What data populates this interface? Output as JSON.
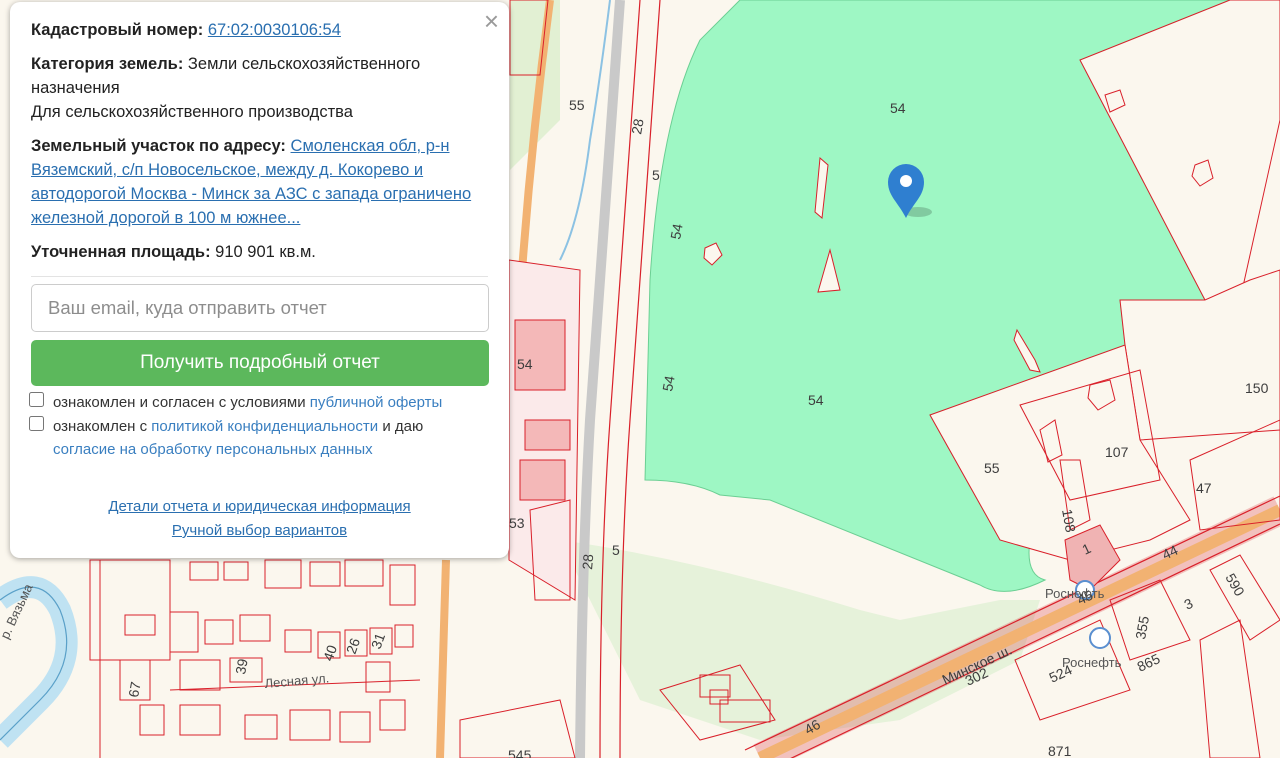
{
  "popup": {
    "close_icon": "×",
    "cadastral_label": "Кадастровый номер:",
    "cadastral_number": "67:02:0030106:54",
    "category_label": "Категория земель:",
    "category_value": "Земли сельскохозяйственного назначения",
    "usage": "Для сельскохозяйственного производства",
    "address_label": "Земельный участок по адресу:",
    "address_value": "Смоленская обл, р-н Вяземский, с/п Новосельское, между д. Кокорево и автодорогой Москва - Минск за АЗС с запада ограничено железной дорогой в 100 м южнее...",
    "area_label": "Уточненная площадь:",
    "area_value": "910 901 кв.м.",
    "email_placeholder": "Ваш email, куда отправить отчет",
    "button_label": "Получить подробный отчет",
    "agree1_text": "ознакомлен и согласен с условиями",
    "agree1_link": "публичной оферты",
    "agree2_text1": "ознакомлен с",
    "agree2_link1": "политикой конфиденциальности",
    "agree2_text2": "и даю",
    "agree2_link2": "согласие на обработку персональных данных",
    "footer_link1": "Детали отчета и юридическая информация",
    "footer_link2": "Ручной выбор вариантов"
  },
  "map": {
    "labels": [
      "54",
      "54",
      "54",
      "54",
      "55",
      "5",
      "28",
      "28",
      "5",
      "54",
      "53",
      "107",
      "108",
      "150",
      "47",
      "55",
      "44",
      "45",
      "1",
      "3",
      "590",
      "355",
      "865",
      "524",
      "302",
      "46",
      "871",
      "545",
      "39",
      "40",
      "26",
      "31",
      "67"
    ],
    "street_label": "Минское ш.",
    "street_label2": "Лесная ул.",
    "river_label": "р. Вязьма",
    "poi_labels": [
      "Роснефть",
      "Роснефть"
    ],
    "parcel_color": "#9ef7c4",
    "border_color": "#d9202a",
    "road_color": "#f2b272",
    "marker_color": "#2f7fd0",
    "marker_icon": "map-pin-icon"
  }
}
